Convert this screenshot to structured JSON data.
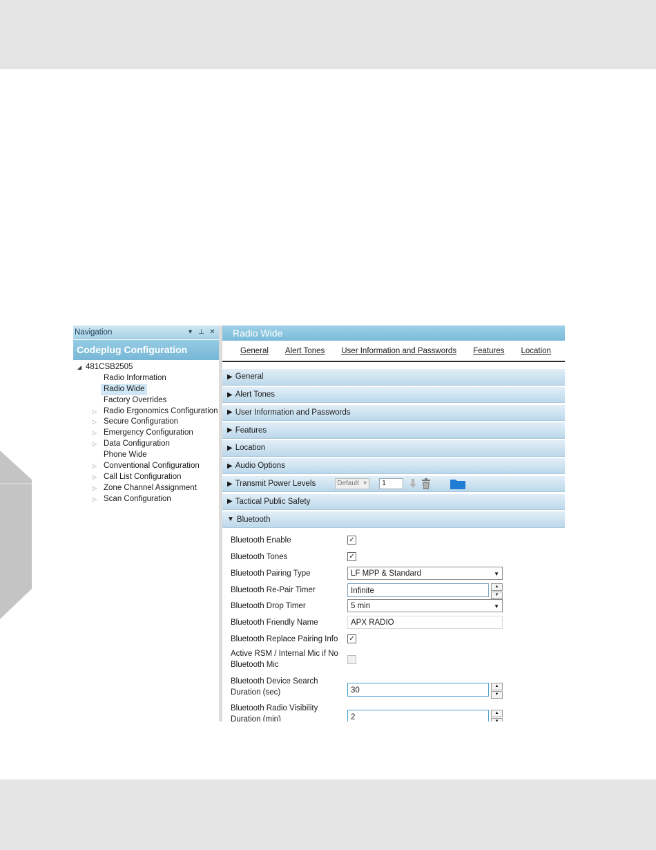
{
  "nav": {
    "header": "Navigation",
    "title": "Codeplug Configuration",
    "root": "481CSB2505",
    "items": [
      {
        "label": "Radio Information",
        "expandable": false,
        "selected": false
      },
      {
        "label": "Radio Wide",
        "expandable": false,
        "selected": true
      },
      {
        "label": "Factory Overrides",
        "expandable": false,
        "selected": false
      },
      {
        "label": "Radio Ergonomics Configuration",
        "expandable": true,
        "selected": false
      },
      {
        "label": "Secure Configuration",
        "expandable": true,
        "selected": false
      },
      {
        "label": "Emergency Configuration",
        "expandable": true,
        "selected": false
      },
      {
        "label": "Data Configuration",
        "expandable": true,
        "selected": false
      },
      {
        "label": "Phone Wide",
        "expandable": false,
        "selected": false
      },
      {
        "label": "Conventional Configuration",
        "expandable": true,
        "selected": false
      },
      {
        "label": "Call List Configuration",
        "expandable": true,
        "selected": false
      },
      {
        "label": "Zone Channel Assignment",
        "expandable": true,
        "selected": false
      },
      {
        "label": "Scan Configuration",
        "expandable": true,
        "selected": false
      }
    ]
  },
  "content": {
    "title": "Radio Wide",
    "tabs": [
      "General",
      "Alert Tones",
      "User Information and Passwords",
      "Features",
      "Location"
    ],
    "sections": {
      "general": "General",
      "alert_tones": "Alert Tones",
      "user_info": "User Information and Passwords",
      "features": "Features",
      "location": "Location",
      "audio_options": "Audio Options",
      "transmit_power": "Transmit Power Levels",
      "transmit_power_dropdown": "Default",
      "transmit_power_value": "1",
      "tactical": "Tactical Public Safety",
      "bluetooth": "Bluetooth"
    },
    "bluetooth": {
      "enable_label": "Bluetooth Enable",
      "tones_label": "Bluetooth Tones",
      "pairing_type_label": "Bluetooth Pairing Type",
      "pairing_type_value": "LF MPP & Standard",
      "repair_timer_label": "Bluetooth Re-Pair Timer",
      "repair_timer_value": "Infinite",
      "drop_timer_label": "Bluetooth Drop Timer",
      "drop_timer_value": "5 min",
      "friendly_name_label": "Bluetooth Friendly Name",
      "friendly_name_value": "APX RADIO",
      "replace_pairing_label": "Bluetooth Replace Pairing Info",
      "active_rsm_label": "Active RSM / Internal Mic if No Bluetooth Mic",
      "search_duration_label": "Bluetooth Device Search Duration (sec)",
      "search_duration_value": "30",
      "visibility_label": "Bluetooth Radio Visibility Duration (min)",
      "visibility_value": "2"
    }
  },
  "colors": {
    "header_blue": "#77b7d6",
    "section_blue": "#bcd8ea",
    "band_gray": "#e4e4e4"
  },
  "icons": {
    "pin": "pin-icon",
    "close": "close-icon",
    "download": "download-arrow-icon",
    "trash": "trash-icon",
    "folder": "folder-icon"
  }
}
